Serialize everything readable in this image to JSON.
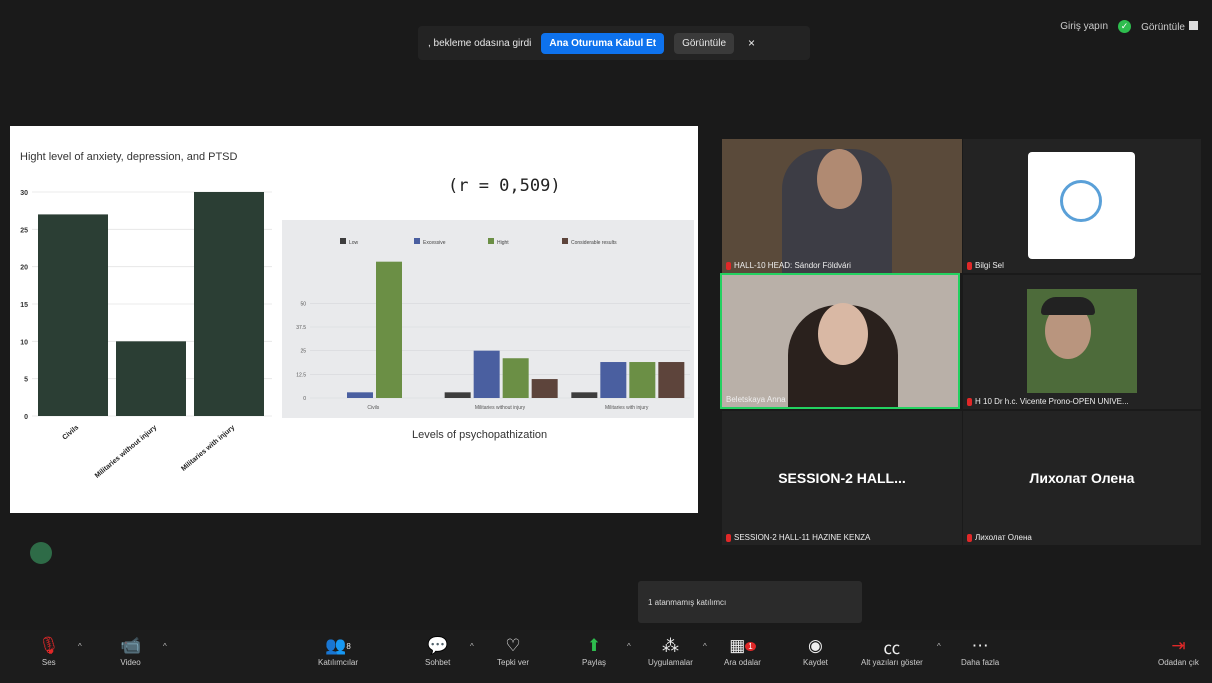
{
  "banner": {
    "message": ", bekleme odasına girdi",
    "admit_label": "Ana Oturuma Kabul Et",
    "view_label": "Görüntüle",
    "close": "×"
  },
  "top_right": {
    "signin": "Giriş yapın",
    "view": "Görüntüle"
  },
  "slide": {
    "left_title": "Hight level of anxiety, depression, and PTSD",
    "r_value": "(r = 0,509)",
    "right_xlabel": "Levels of psychopathization"
  },
  "chart_data": [
    {
      "type": "bar",
      "title": "Hight level of anxiety, depression, and PTSD",
      "categories": [
        "Civils",
        "Militaries without injury",
        "Militaries with injury"
      ],
      "values": [
        27,
        10,
        30
      ],
      "ylim": [
        0,
        30
      ],
      "yticks": [
        0,
        5,
        10,
        15,
        20,
        25,
        30
      ],
      "color": "#2b3e34"
    },
    {
      "type": "bar",
      "xlabel": "Levels of psychopathization",
      "categories": [
        "Civils",
        "Militaries without injury",
        "Militaries with injury"
      ],
      "series": [
        {
          "name": "Low",
          "values": [
            0,
            3,
            3
          ],
          "color": "#3d3d3d"
        },
        {
          "name": "Excessive",
          "values": [
            3,
            25,
            19
          ],
          "color": "#4a5fa0"
        },
        {
          "name": "Hight",
          "values": [
            72,
            21,
            19
          ],
          "color": "#6b8f45"
        },
        {
          "name": "Considerable results",
          "values": [
            0,
            10,
            19
          ],
          "color": "#5d443b"
        }
      ],
      "ylim": [
        0,
        75
      ],
      "yticks": [
        0,
        12.5,
        25,
        37.5,
        50
      ]
    }
  ],
  "participants": [
    {
      "name": "HALL-10 HEAD: Sándor Földvári",
      "muted": true
    },
    {
      "name": "Bilgi Sel",
      "muted": true
    },
    {
      "name": "Beletskaya Anna",
      "muted": false
    },
    {
      "name": "H 10 Dr h.c. Vicente Prono-OPEN UNIVE...",
      "muted": true
    },
    {
      "name": "SESSION-2 HALL-11 HAZINE KENZA",
      "big": "SESSION-2  HALL...",
      "muted": true
    },
    {
      "name": "Лихолат Олена",
      "big": "Лихолат Олена",
      "muted": true
    }
  ],
  "toast": "1 atanmamış katılımcı",
  "toolbar": {
    "audio": "Ses",
    "video": "Video",
    "participants": "Katılımcılar",
    "participants_count": "8",
    "chat": "Sohbet",
    "react": "Tepki ver",
    "share": "Paylaş",
    "apps": "Uygulamalar",
    "breakout": "Ara odalar",
    "breakout_badge": "1",
    "record": "Kaydet",
    "captions": "Alt yazıları göster",
    "more": "Daha fazla",
    "leave": "Odadan çık"
  },
  "colors": {
    "accent": "#0e72ed",
    "active_speaker": "#23d160",
    "mic_off": "#e02828"
  }
}
